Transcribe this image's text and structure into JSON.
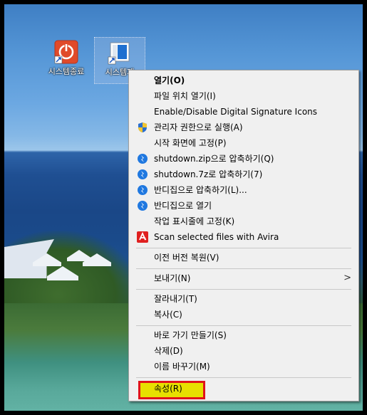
{
  "desktop": {
    "icons": [
      {
        "label": "시스템종료",
        "icon": "power-button-icon",
        "color": "#e04a2a"
      },
      {
        "label": "시스템재",
        "icon": "shortcut-window-icon",
        "color": "#1f6fd0"
      }
    ]
  },
  "context_menu": {
    "items": [
      {
        "label": "열기(O)",
        "bold": true
      },
      {
        "label": "파일 위치 열기(I)"
      },
      {
        "label": "Enable/Disable Digital Signature Icons"
      },
      {
        "label": "관리자 권한으로 실행(A)",
        "icon": "uac-shield-icon"
      },
      {
        "label": "시작 화면에 고정(P)"
      },
      {
        "label": "shutdown.zip으로 압축하기(Q)",
        "icon": "bandizip-icon"
      },
      {
        "label": "shutdown.7z로 압축하기(7)",
        "icon": "bandizip-icon"
      },
      {
        "label": "반디집으로 압축하기(L)...",
        "icon": "bandizip-icon"
      },
      {
        "label": "반디집으로 열기",
        "icon": "bandizip-icon"
      },
      {
        "label": "작업 표시줄에 고정(K)"
      },
      {
        "label": "Scan selected files with Avira",
        "icon": "avira-icon"
      },
      {
        "label": "이전 버전 복원(V)"
      },
      {
        "label": "보내기(N)",
        "submenu": true
      },
      {
        "label": "잘라내기(T)"
      },
      {
        "label": "복사(C)"
      },
      {
        "label": "바로 가기 만들기(S)"
      },
      {
        "label": "삭제(D)"
      },
      {
        "label": "이름 바꾸기(M)"
      },
      {
        "label": "속성(R)",
        "highlighted": true
      }
    ],
    "highlight_color": "#e7e000",
    "highlight_border": "#e0141a",
    "submenu_arrow": ">"
  }
}
